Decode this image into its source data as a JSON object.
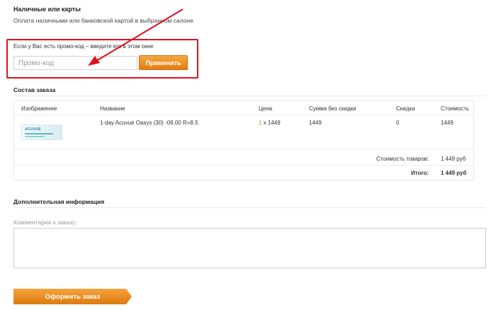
{
  "payment": {
    "title": "Наличные или карты",
    "description": "Оплата наличными или банковской картой в выбранном салоне"
  },
  "promo": {
    "hint": "Если у Вас есть промо-код – введите его в этом окне",
    "placeholder": "Промо-код",
    "value": "",
    "apply_label": "Применить"
  },
  "order": {
    "title": "Состав заказа",
    "columns": [
      "Изображение",
      "Название",
      "Цена",
      "Сумма без скидки",
      "Скидка",
      "Стоимость"
    ],
    "items": [
      {
        "image_icon": "contact-lens-box-icon",
        "image_brand": "ACUVUE",
        "name": "1-day Acuvue Oasys (30) -09.00 R=8.5",
        "qty": "1",
        "price_suffix": "x 1449",
        "sum_without_discount": "1449",
        "discount": "0",
        "cost": "1449"
      }
    ],
    "goods_total_label": "Стоимость товаров:",
    "goods_total_value": "1 449 руб",
    "grand_total_label": "Итого:",
    "grand_total_value": "1 449 руб"
  },
  "additional": {
    "title": "Дополнительная информация",
    "comment_label": "Комментарии к заказу:",
    "comment_value": ""
  },
  "submit": {
    "label": "Оформить заказ"
  },
  "colors": {
    "accent": "#e8891a",
    "highlight_box": "#e0101e",
    "arrow": "#e0101e"
  }
}
